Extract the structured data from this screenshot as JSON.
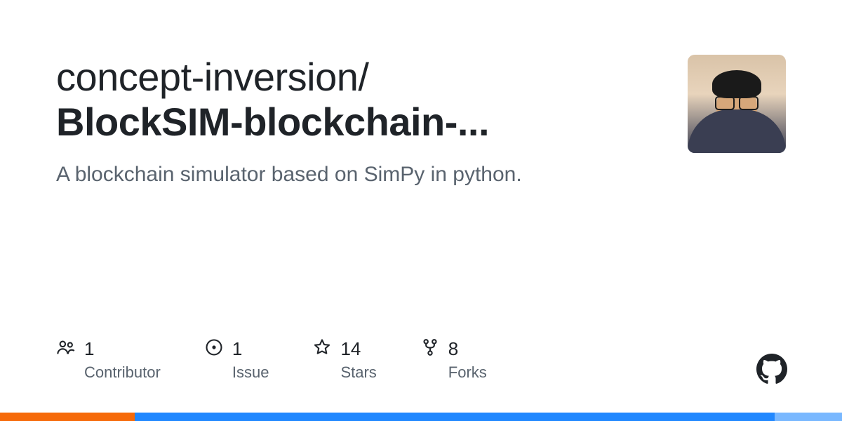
{
  "repo": {
    "owner": "concept-inversion",
    "separator": "/",
    "name": "BlockSIM-blockchain-...",
    "description": "A blockchain simulator based on SimPy in python."
  },
  "stats": [
    {
      "icon": "people-icon",
      "count": "1",
      "label": "Contributor"
    },
    {
      "icon": "issue-icon",
      "count": "1",
      "label": "Issue"
    },
    {
      "icon": "star-icon",
      "count": "14",
      "label": "Stars"
    },
    {
      "icon": "fork-icon",
      "count": "8",
      "label": "Forks"
    }
  ],
  "colors": {
    "bar1": "#f66a0a",
    "bar2": "#2188ff",
    "bar3": "#79b8ff"
  }
}
